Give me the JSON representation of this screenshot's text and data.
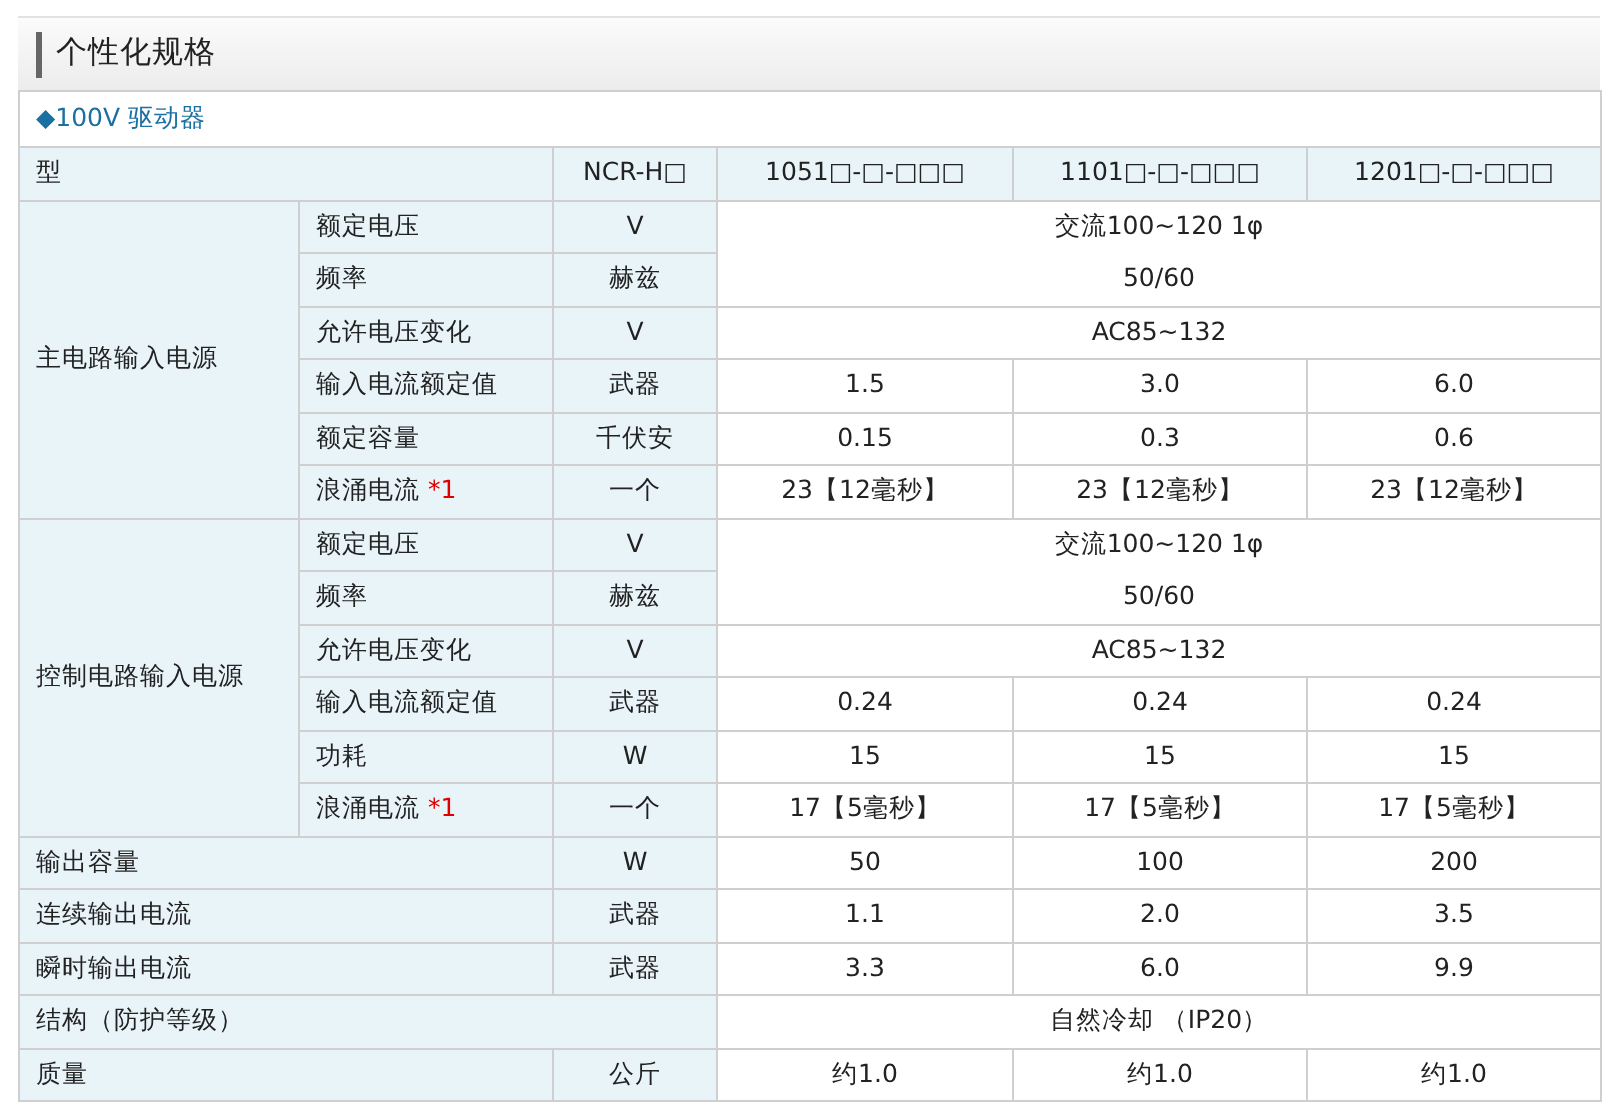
{
  "title": "个性化规格",
  "section": {
    "marker": "◆",
    "label": "100V 驱动器"
  },
  "header": {
    "label": "型",
    "unit": "NCR-H□",
    "models": [
      "1051□-□-□□□",
      "1101□-□-□□□",
      "1201□-□-□□□"
    ]
  },
  "body": [
    {
      "kind": "group",
      "label": "主电路输入电源",
      "rows": [
        {
          "item": "额定电压",
          "unit": "V",
          "values": [
            "交流100~120 1φ"
          ],
          "joined_below": true
        },
        {
          "item": "频率",
          "unit": "赫兹",
          "values": [
            "50/60"
          ]
        },
        {
          "item": "允许电压变化",
          "unit": "V",
          "values": [
            "AC85~132"
          ]
        },
        {
          "item": "输入电流额定值",
          "unit": "武器",
          "values": [
            "1.5",
            "3.0",
            "6.0"
          ]
        },
        {
          "item": "额定容量",
          "unit": "千伏安",
          "values": [
            "0.15",
            "0.3",
            "0.6"
          ]
        },
        {
          "item": "浪涌电流",
          "note": "*1",
          "unit": "一个",
          "values": [
            "23【12毫秒】",
            "23【12毫秒】",
            "23【12毫秒】"
          ]
        }
      ]
    },
    {
      "kind": "group",
      "label": "控制电路输入电源",
      "rows": [
        {
          "item": "额定电压",
          "unit": "V",
          "values": [
            "交流100~120 1φ"
          ],
          "joined_below": true
        },
        {
          "item": "频率",
          "unit": "赫兹",
          "values": [
            "50/60"
          ]
        },
        {
          "item": "允许电压变化",
          "unit": "V",
          "values": [
            "AC85~132"
          ]
        },
        {
          "item": "输入电流额定值",
          "unit": "武器",
          "values": [
            "0.24",
            "0.24",
            "0.24"
          ]
        },
        {
          "item": "功耗",
          "unit": "W",
          "values": [
            "15",
            "15",
            "15"
          ]
        },
        {
          "item": "浪涌电流",
          "note": "*1",
          "unit": "一个",
          "values": [
            "17【5毫秒】",
            "17【5毫秒】",
            "17【5毫秒】"
          ]
        }
      ]
    },
    {
      "kind": "row",
      "label": "输出容量",
      "unit": "W",
      "values": [
        "50",
        "100",
        "200"
      ]
    },
    {
      "kind": "row",
      "label": "连续输出电流",
      "unit": "武器",
      "values": [
        "1.1",
        "2.0",
        "3.5"
      ]
    },
    {
      "kind": "row",
      "label": "瞬时输出电流",
      "unit": "武器",
      "values": [
        "3.3",
        "6.0",
        "9.9"
      ]
    },
    {
      "kind": "row",
      "label": "结构（防护等级）",
      "values": [
        "自然冷却 （IP20）"
      ]
    },
    {
      "kind": "row",
      "label": "质量",
      "unit": "公斤",
      "values": [
        "约1.0",
        "约1.0",
        "约1.0"
      ]
    }
  ]
}
